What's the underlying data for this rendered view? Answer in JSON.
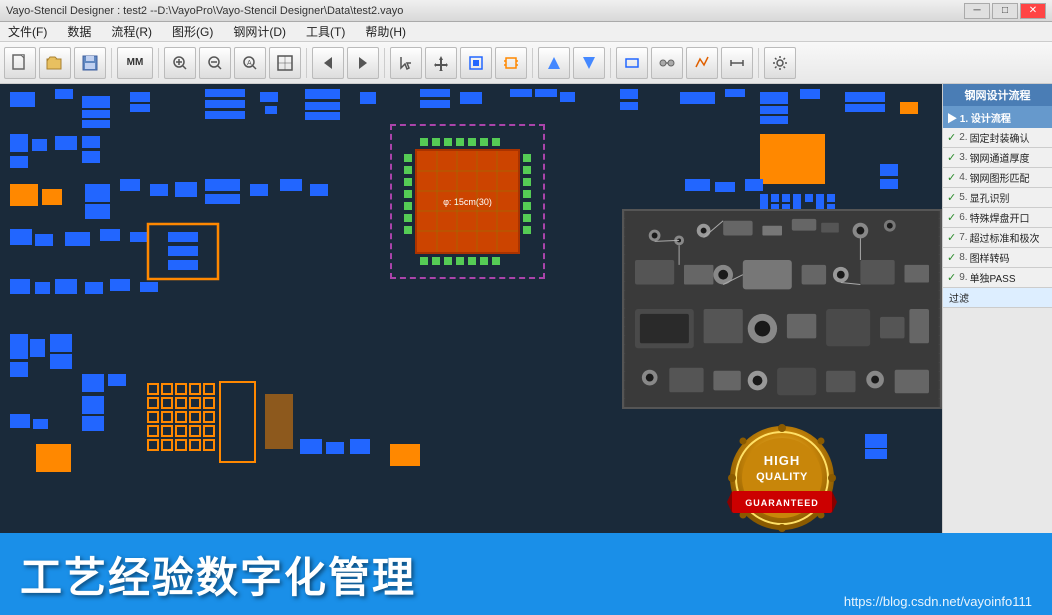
{
  "titlebar": {
    "title": "Vayo-Stencil Designer : test2  --D:\\VayoPro\\Vayo-Stencil Designer\\Data\\test2.vayo",
    "minimize": "─",
    "maximize": "□",
    "close": "✕"
  },
  "menubar": {
    "items": [
      "文件(F)",
      "数据",
      "流程(R)",
      "图形(G)",
      "钢网计(D)",
      "工具(T)",
      "帮助(H)"
    ]
  },
  "toolbar": {
    "buttons": [
      "新建",
      "打开",
      "保存",
      "MM",
      "放大",
      "缩小",
      "全图",
      "适合",
      "旋转",
      "移动",
      "选择",
      "元件",
      "连线",
      "删除",
      "测量",
      "属性",
      "设置",
      "帮助"
    ]
  },
  "right_panel": {
    "header": "钢网设计流程",
    "items": [
      {
        "num": "2.",
        "label": "固定封装确认",
        "checked": true
      },
      {
        "num": "3.",
        "label": "钢网通道厚度",
        "checked": true
      },
      {
        "num": "4.",
        "label": "钢网图形匹配",
        "checked": true
      },
      {
        "num": "5.",
        "label": "显孔识别",
        "checked": true
      },
      {
        "num": "6.",
        "label": "特殊焊盘开口",
        "checked": true
      },
      {
        "num": "7.",
        "label": "超过标准和极次",
        "checked": true
      },
      {
        "num": "8.",
        "label": "图样转码",
        "checked": true
      },
      {
        "num": "9.",
        "label": "单独PASS",
        "checked": true
      },
      {
        "num": "",
        "label": "过滤",
        "checked": false
      }
    ]
  },
  "ic_chip": {
    "label": "φ: 15cm(30)"
  },
  "badge": {
    "high": "HIGH",
    "quality": "QUALITY",
    "guaranteed": "GUARANTEED"
  },
  "bottom": {
    "main_text": "工艺经验数字化管理",
    "url": "https://blog.csdn.net/vayoinfo111"
  }
}
